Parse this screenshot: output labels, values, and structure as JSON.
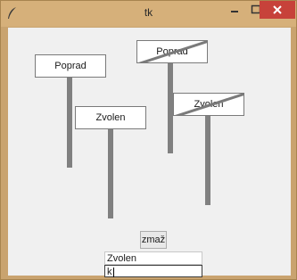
{
  "window": {
    "title": "tk",
    "app_icon": "feather-icon",
    "controls": {
      "minimize_icon": "minimize-icon",
      "maximize_icon": "maximize-icon",
      "close_icon": "close-icon"
    }
  },
  "signs": [
    {
      "label": "Poprad",
      "crossed": false
    },
    {
      "label": "Zvolen",
      "crossed": false
    },
    {
      "label": "Poprad",
      "crossed": true
    },
    {
      "label": "Zvolen",
      "crossed": true
    }
  ],
  "controls": {
    "delete_button": "zmaž",
    "text_entry_value": "Zvolen",
    "second_entry_value": "k"
  },
  "colors": {
    "title_bar": "#d6b07a",
    "close_button": "#c7423a",
    "post": "#808080",
    "background": "#f0f0f0"
  }
}
